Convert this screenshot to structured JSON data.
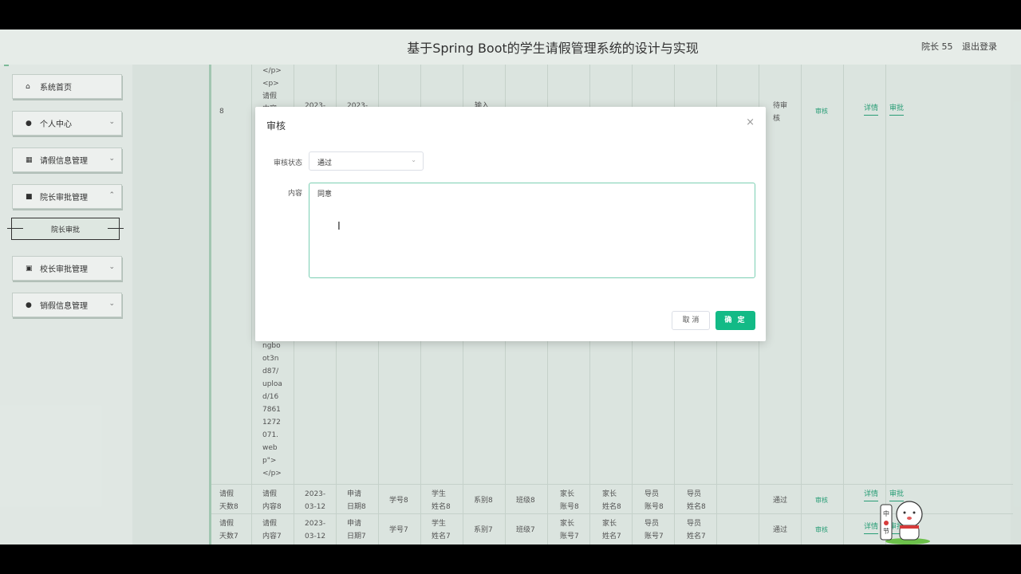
{
  "header": {
    "title": "基于Spring Boot的学生请假管理系统的设计与实现",
    "user": "院长 55",
    "logout": "退出登录"
  },
  "sidebar": {
    "items": [
      {
        "label": "系统首页",
        "icon": "home-icon"
      },
      {
        "label": "个人中心",
        "icon": "person-icon"
      },
      {
        "label": "请假信息管理",
        "icon": "grid-icon"
      },
      {
        "label": "院长审批管理",
        "icon": "briefcase-icon"
      },
      {
        "label": "校长审批管理",
        "icon": "clipboard-icon"
      },
      {
        "label": "销假信息管理",
        "icon": "person-icon"
      }
    ],
    "submenu_active": "院长审批"
  },
  "table": {
    "top_row": {
      "id": "8",
      "content_fragments": [
        "</p>",
        "<p>",
        "请假",
        "内容"
      ],
      "date": "2023-",
      "apply": "2023-",
      "col_input": "输入",
      "status": "待审",
      "status2": "核",
      "review_link": "审核",
      "detail": "详情",
      "approve": "审批"
    },
    "url_fragments": [
      "ngbo",
      "ot3n",
      "d87/",
      "uploa",
      "d/16",
      "7861",
      "1272",
      "071.",
      "web",
      "p\">",
      "</p>"
    ],
    "rows": [
      {
        "days": [
          "请假",
          "天数8"
        ],
        "content": [
          "请假",
          "内容8"
        ],
        "date": [
          "2023-",
          "03-12"
        ],
        "apply": [
          "申请",
          "日期8"
        ],
        "sno": "学号8",
        "sname": [
          "学生",
          "姓名8"
        ],
        "dept": "系别8",
        "cls": "班级8",
        "pno": [
          "家长",
          "账号8"
        ],
        "pname": [
          "家长",
          "姓名8"
        ],
        "tno": [
          "导员",
          "账号8"
        ],
        "tname": [
          "导员",
          "姓名8"
        ],
        "status": "通过",
        "review": "审核",
        "detail": "详情",
        "approve": "审批"
      },
      {
        "days": [
          "请假",
          "天数7"
        ],
        "content": [
          "请假",
          "内容7"
        ],
        "date": [
          "2023-",
          "03-12"
        ],
        "apply": [
          "申请",
          "日期7"
        ],
        "sno": "学号7",
        "sname": [
          "学生",
          "姓名7"
        ],
        "dept": "系别7",
        "cls": "班级7",
        "pno": [
          "家长",
          "账号7"
        ],
        "pname": [
          "家长",
          "姓名7"
        ],
        "tno": [
          "导员",
          "账号7"
        ],
        "tname": [
          "导员",
          "姓名7"
        ],
        "status": "通过",
        "review": "审核",
        "detail": "详情",
        "approve": "审批"
      }
    ]
  },
  "modal": {
    "title": "审核",
    "status_label": "审核状态",
    "status_value": "通过",
    "content_label": "内容",
    "content_value": "同意",
    "cancel": "取 消",
    "confirm": "确 定"
  },
  "colors": {
    "primary": "#13ba86",
    "accent_border": "#7ccfb3"
  }
}
